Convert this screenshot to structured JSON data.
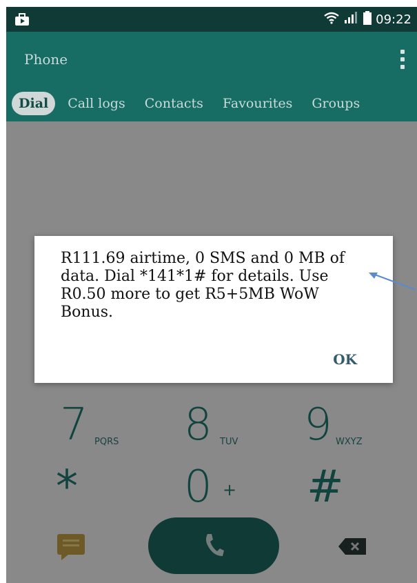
{
  "status_bar": {
    "time": "09:22",
    "icons": [
      "briefcase-play-icon",
      "wifi-icon",
      "signal-icon",
      "battery-icon"
    ]
  },
  "app_bar": {
    "title": "Phone",
    "menu_icon": "overflow-menu-icon"
  },
  "tabs": [
    {
      "label": "Dial",
      "active": true
    },
    {
      "label": "Call logs",
      "active": false
    },
    {
      "label": "Contacts",
      "active": false
    },
    {
      "label": "Favourites",
      "active": false
    },
    {
      "label": "Groups",
      "active": false
    }
  ],
  "dialog": {
    "message": "R111.69 airtime, 0 SMS and 0 MB of data. Dial *141*1# for details. Use R0.50 more to get R5+5MB WoW Bonus.",
    "ok_label": "OK"
  },
  "keypad": {
    "row_7": {
      "num": "7",
      "letters": "PQRS"
    },
    "row_8": {
      "num": "8",
      "letters": "TUV"
    },
    "row_9": {
      "num": "9",
      "letters": "WXYZ"
    },
    "star": "*",
    "zero": "0",
    "zero_sub": "+",
    "hash": "#"
  },
  "bottom_actions": {
    "message_icon": "message-icon",
    "call_icon": "call-icon",
    "backspace_icon": "backspace-icon"
  },
  "colors": {
    "status_bar": "#0f3a36",
    "app_bar": "#176c64",
    "accent": "#1f7b73",
    "call_button": "#1d6a63",
    "arrow": "#5b8bc9"
  }
}
